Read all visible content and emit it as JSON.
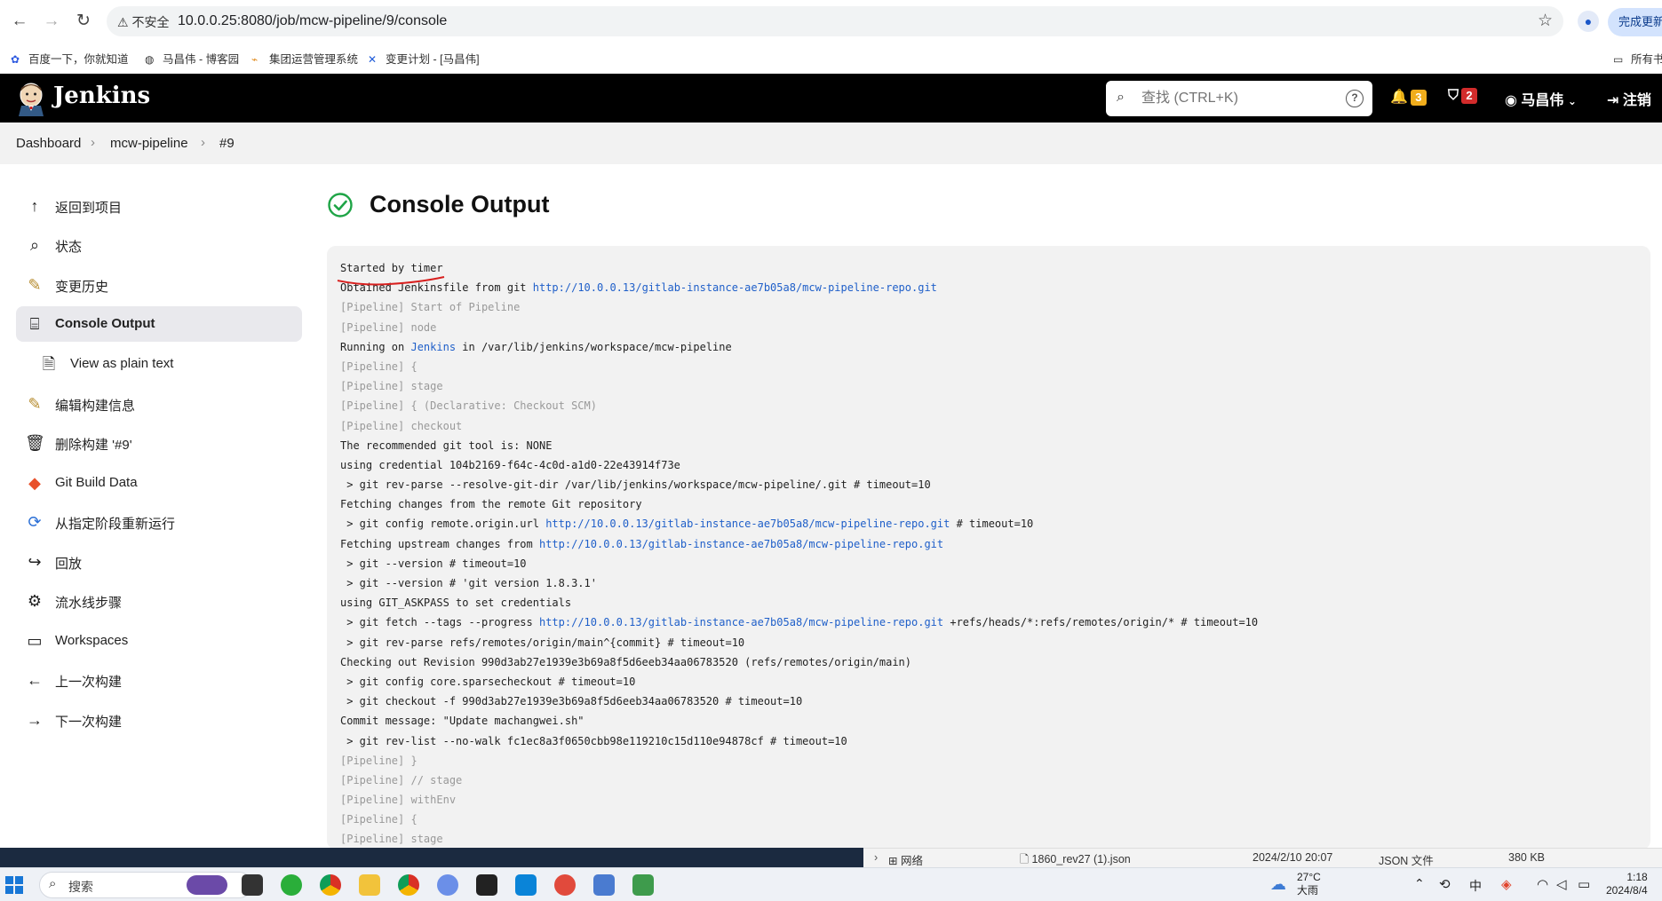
{
  "browser": {
    "security_label": "不安全",
    "url": "10.0.0.25:8080/job/mcw-pipeline/9/console",
    "update_button": "完成更新",
    "bookmarks": [
      {
        "label": "百度一下，你就知道",
        "icon": "baidu-paw-icon"
      },
      {
        "label": "马昌伟 - 博客园",
        "icon": "cnblogs-icon"
      },
      {
        "label": "集团运营管理系统",
        "icon": "chart-icon"
      },
      {
        "label": "变更计划 - [马昌伟]",
        "icon": "jira-icon"
      }
    ],
    "bookmarks_folder": "所有书签"
  },
  "header": {
    "app_name": "Jenkins",
    "search_placeholder": "查找 (CTRL+K)",
    "notifications_count": "3",
    "security_count": "2",
    "user_name": "马昌伟",
    "logout_label": "注销",
    "colors": {
      "bg": "#000000",
      "notify": "#f0ad1c",
      "security": "#d22b2b"
    }
  },
  "breadcrumb": [
    "Dashboard",
    "mcw-pipeline",
    "#9"
  ],
  "sidebar": {
    "items": [
      {
        "label": "返回到项目",
        "icon": "arrow-up-icon"
      },
      {
        "label": "状态",
        "icon": "search-icon"
      },
      {
        "label": "变更历史",
        "icon": "notepad-icon"
      },
      {
        "label": "Console Output",
        "icon": "terminal-icon"
      },
      {
        "label": "View as plain text",
        "icon": "document-icon"
      },
      {
        "label": "编辑构建信息",
        "icon": "notepad-icon"
      },
      {
        "label": "删除构建 '#9'",
        "icon": "trash-icon"
      },
      {
        "label": "Git Build Data",
        "icon": "git-icon"
      },
      {
        "label": "从指定阶段重新运行",
        "icon": "restart-icon"
      },
      {
        "label": "回放",
        "icon": "replay-icon"
      },
      {
        "label": "流水线步骤",
        "icon": "gear-icon"
      },
      {
        "label": "Workspaces",
        "icon": "folder-icon"
      },
      {
        "label": "上一次构建",
        "icon": "arrow-left-icon"
      },
      {
        "label": "下一次构建",
        "icon": "arrow-right-icon"
      }
    ]
  },
  "main": {
    "title": "Console Output",
    "lines": [
      {
        "text": "Started by timer"
      },
      {
        "text": "Obtained Jenkinsfile from git ",
        "link": "http://10.0.0.13/gitlab-instance-ae7b05a8/mcw-pipeline-repo.git"
      },
      {
        "text": "[Pipeline] Start of Pipeline",
        "muted": true
      },
      {
        "text": "[Pipeline] node",
        "muted": true
      },
      {
        "text": "Running on ",
        "link": "Jenkins",
        "after": " in /var/lib/jenkins/workspace/mcw-pipeline"
      },
      {
        "text": "[Pipeline] {",
        "muted": true
      },
      {
        "text": "[Pipeline] stage",
        "muted": true
      },
      {
        "text": "[Pipeline] { (Declarative: Checkout SCM)",
        "muted": true
      },
      {
        "text": "[Pipeline] checkout",
        "muted": true
      },
      {
        "text": "The recommended git tool is: NONE"
      },
      {
        "text": "using credential 104b2169-f64c-4c0d-a1d0-22e43914f73e"
      },
      {
        "text": " > git rev-parse --resolve-git-dir /var/lib/jenkins/workspace/mcw-pipeline/.git # timeout=10"
      },
      {
        "text": "Fetching changes from the remote Git repository"
      },
      {
        "text": " > git config remote.origin.url ",
        "link": "http://10.0.0.13/gitlab-instance-ae7b05a8/mcw-pipeline-repo.git",
        "after": " # timeout=10"
      },
      {
        "text": "Fetching upstream changes from ",
        "link": "http://10.0.0.13/gitlab-instance-ae7b05a8/mcw-pipeline-repo.git"
      },
      {
        "text": " > git --version # timeout=10"
      },
      {
        "text": " > git --version # 'git version 1.8.3.1'"
      },
      {
        "text": "using GIT_ASKPASS to set credentials"
      },
      {
        "text": " > git fetch --tags --progress ",
        "link": "http://10.0.0.13/gitlab-instance-ae7b05a8/mcw-pipeline-repo.git",
        "after": " +refs/heads/*:refs/remotes/origin/* # timeout=10"
      },
      {
        "text": " > git rev-parse refs/remotes/origin/main^{commit} # timeout=10"
      },
      {
        "text": "Checking out Revision 990d3ab27e1939e3b69a8f5d6eeb34aa06783520 (refs/remotes/origin/main)"
      },
      {
        "text": " > git config core.sparsecheckout # timeout=10"
      },
      {
        "text": " > git checkout -f 990d3ab27e1939e3b69a8f5d6eeb34aa06783520 # timeout=10"
      },
      {
        "text": "Commit message: \"Update machangwei.sh\""
      },
      {
        "text": " > git rev-list --no-walk fc1ec8a3f0650cbb98e119210c15d110e94878cf # timeout=10"
      },
      {
        "text": "[Pipeline] }",
        "muted": true
      },
      {
        "text": "[Pipeline] // stage",
        "muted": true
      },
      {
        "text": "[Pipeline] withEnv",
        "muted": true
      },
      {
        "text": "[Pipeline] {",
        "muted": true
      },
      {
        "text": "[Pipeline] stage",
        "muted": true
      }
    ]
  },
  "explorer": {
    "tree_label": "网络",
    "file_name": "1860_rev27 (1).json",
    "file_date": "2024/2/10 20:07",
    "file_type": "JSON 文件",
    "file_size": "380 KB"
  },
  "taskbar": {
    "search_label": "搜索",
    "weather_temp": "27°C",
    "weather_desc": "大雨",
    "ime": "中",
    "time": "1:18",
    "date": "2024/8/4"
  }
}
